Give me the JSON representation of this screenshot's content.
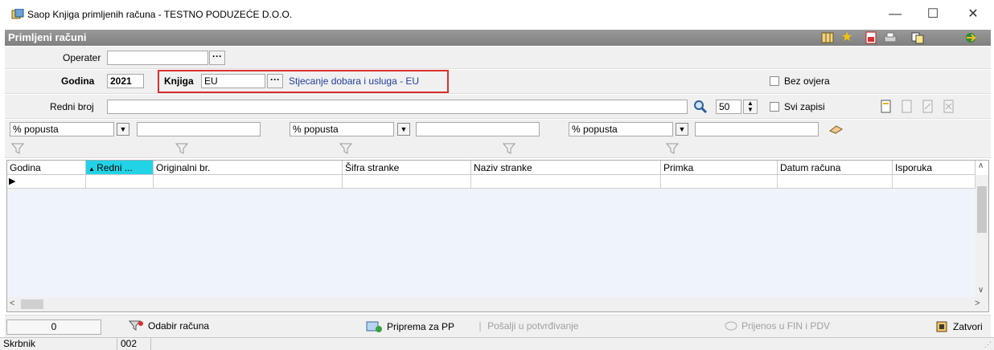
{
  "window": {
    "title": "Saop Knjiga primljenih računa - TESTNO PODUZEĆE D.O.O.",
    "minimize": "—",
    "maximize": "☐",
    "close": "✕"
  },
  "panel": {
    "title": "Primljeni računi"
  },
  "operater": {
    "label": "Operater",
    "value": "",
    "button": "···"
  },
  "godina": {
    "label": "Godina",
    "value": "2021"
  },
  "knjiga": {
    "label": "Knjiga",
    "value": "EU",
    "button": "···",
    "description": "Stjecanje dobara i usluga - EU"
  },
  "bez_ovjera": {
    "label": "Bez ovjera",
    "checked": false
  },
  "redni_broj": {
    "label": "Redni broj",
    "value": ""
  },
  "limit": {
    "value": "50"
  },
  "svi_zapisi": {
    "label": "Svi zapisi",
    "checked": false
  },
  "filters": [
    {
      "select": "% popusta",
      "value": ""
    },
    {
      "select": "% popusta",
      "value": ""
    },
    {
      "select": "% popusta",
      "value": ""
    }
  ],
  "grid": {
    "columns": [
      "Godina",
      "Redni ...",
      "Originalni br.",
      "Šifra stranke",
      "Naziv stranke",
      "Primka",
      "Datum računa",
      "Isporuka"
    ],
    "sorted_column": "Redni ..."
  },
  "bottom": {
    "count": "0",
    "odabir": "Odabir računa",
    "priprema": "Priprema za PP",
    "posalji": "Pošalji u potvrđivanje",
    "prijenos": "Prijenos u FIN i PDV",
    "zatvori": "Zatvori"
  },
  "status": {
    "user_label": "Skrbnik",
    "user_code": "002"
  },
  "colors": {
    "header_bg": "#8a8a8a",
    "sorted_col": "#22d3e6",
    "highlight": "#d9302c",
    "link": "#1f3f9f"
  }
}
